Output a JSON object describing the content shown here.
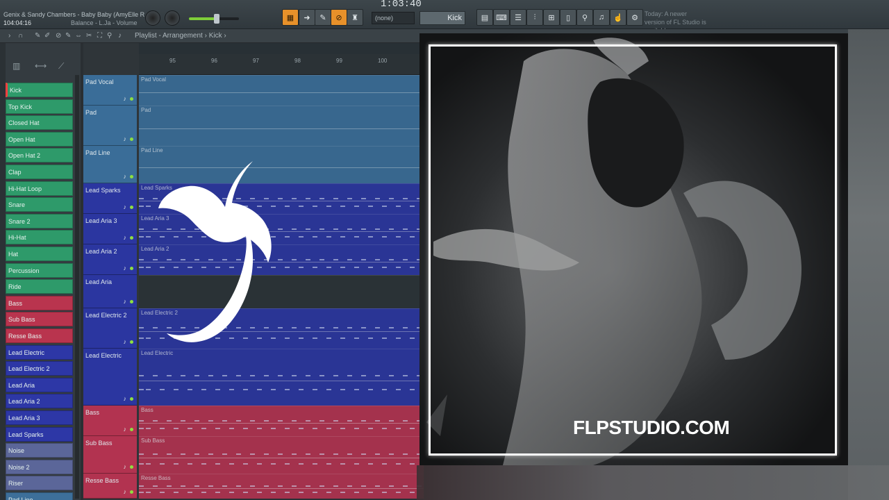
{
  "toolbar": {
    "song_title": "Genix & Sandy Chambers - Baby Baby (AmyElle R",
    "song_time": "104:04:16",
    "hint": "Balance - L.Ja - Volume",
    "clock": "1:03:40",
    "pattern_select": "(none)",
    "pattern_name": "Kick",
    "news": "Today: A newer version of FL Studio is available"
  },
  "playlist": {
    "breadcrumb": "Playlist - Arrangement › Kick ›",
    "ruler": [
      "95",
      "96",
      "97",
      "98",
      "99",
      "100"
    ]
  },
  "picker": {
    "items": [
      {
        "label": "Kick",
        "color": "#2e9a6a"
      },
      {
        "label": "Top Kick",
        "color": "#2e9a6a"
      },
      {
        "label": "Closed Hat",
        "color": "#2e9a6a"
      },
      {
        "label": "Open Hat",
        "color": "#2e9a6a"
      },
      {
        "label": "Open Hat 2",
        "color": "#2e9a6a"
      },
      {
        "label": "Clap",
        "color": "#2e9a6a"
      },
      {
        "label": "Hi-Hat Loop",
        "color": "#2e9a6a"
      },
      {
        "label": "Snare",
        "color": "#2e9a6a"
      },
      {
        "label": "Snare 2",
        "color": "#2e9a6a"
      },
      {
        "label": "Hi-Hat",
        "color": "#2e9a6a"
      },
      {
        "label": "Hat",
        "color": "#2e9a6a"
      },
      {
        "label": "Percussion",
        "color": "#2e9a6a"
      },
      {
        "label": "Ride",
        "color": "#2e9a6a"
      },
      {
        "label": "Bass",
        "color": "#b9344e"
      },
      {
        "label": "Sub Bass",
        "color": "#b9344e"
      },
      {
        "label": "Resse Bass",
        "color": "#b9344e"
      },
      {
        "label": "Lead Electric",
        "color": "#2d37a6"
      },
      {
        "label": "Lead Electric 2",
        "color": "#2d37a6"
      },
      {
        "label": "Lead Aria",
        "color": "#2d37a6"
      },
      {
        "label": "Lead Aria 2",
        "color": "#2d37a6"
      },
      {
        "label": "Lead Aria 3",
        "color": "#2d37a6"
      },
      {
        "label": "Lead Sparks",
        "color": "#2d37a6"
      },
      {
        "label": "Noise",
        "color": "#5b6699"
      },
      {
        "label": "Noise 2",
        "color": "#5b6699"
      },
      {
        "label": "Riser",
        "color": "#5b6699"
      },
      {
        "label": "Pad Line",
        "color": "#3d6f9a"
      }
    ]
  },
  "tracks": [
    {
      "name": "Pad Vocal",
      "clip": "Pad Vocal",
      "color": "#3a6d98"
    },
    {
      "name": "Pad",
      "clip": "Pad",
      "color": "#3a6d98"
    },
    {
      "name": "Pad Line",
      "clip": "Pad Line",
      "color": "#3a6d98"
    },
    {
      "name": "Lead Sparks",
      "clip": "Lead Sparks",
      "color": "#2b36a0"
    },
    {
      "name": "Lead Aria 3",
      "clip": "Lead Aria 3",
      "color": "#2b36a0"
    },
    {
      "name": "Lead Aria 2",
      "clip": "Lead Aria 2",
      "color": "#2b36a0"
    },
    {
      "name": "Lead Aria",
      "clip": "",
      "color": "#2b36a0"
    },
    {
      "name": "Lead Electric 2",
      "clip": "Lead Electric 2",
      "color": "#2b36a0"
    },
    {
      "name": "Lead Electric",
      "clip": "Lead Electric",
      "color": "#2b36a0"
    },
    {
      "name": "Bass",
      "clip": "Bass",
      "color": "#b23350"
    },
    {
      "name": "Sub Bass",
      "clip": "Sub Bass",
      "color": "#b23350"
    },
    {
      "name": "Resse Bass",
      "clip": "Resse Bass",
      "color": "#b23350"
    }
  ],
  "cover": {
    "caption": "FLPSTUDIO.COM"
  },
  "colors": {
    "accent_orange": "#e8912a",
    "frame": "#ffffff",
    "led": "#8ee03f"
  }
}
